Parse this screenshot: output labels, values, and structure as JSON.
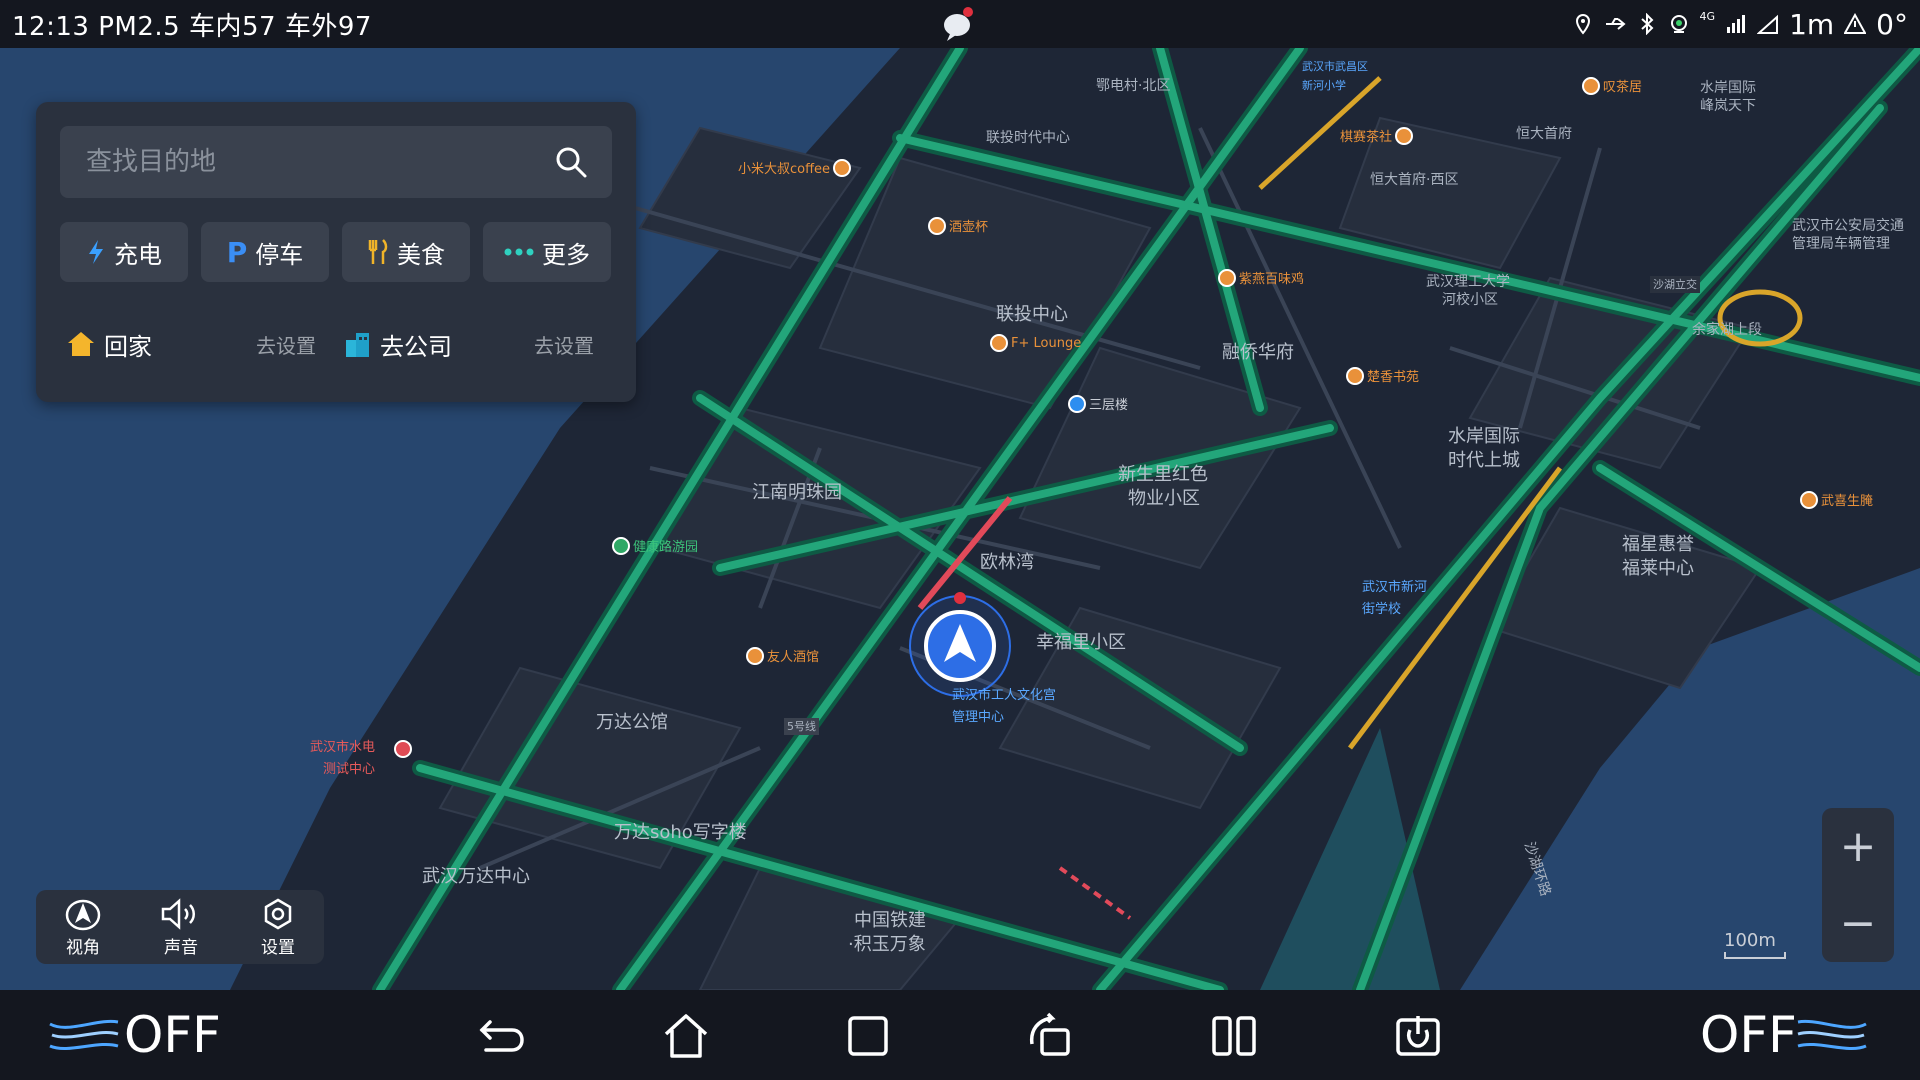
{
  "status_bar": {
    "time": "12:13",
    "pm25": "PM2.5",
    "inside_label": "车内",
    "inside_value": "57",
    "outside_label": "车外",
    "outside_value": "97",
    "signal_label": "4G",
    "distance": "1m",
    "angle": "0°"
  },
  "search": {
    "placeholder": "查找目的地",
    "categories": [
      {
        "label": "充电",
        "icon": "lightning-icon"
      },
      {
        "label": "停车",
        "icon": "parking-icon"
      },
      {
        "label": "美食",
        "icon": "food-icon"
      },
      {
        "label": "更多",
        "icon": "more-dots-icon"
      }
    ],
    "home_label": "回家",
    "home_action": "去设置",
    "company_label": "去公司",
    "company_action": "去设置"
  },
  "view_controls": {
    "perspective_label": "视角",
    "sound_label": "声音",
    "settings_label": "设置"
  },
  "zoom": {
    "in": "+",
    "out": "−",
    "scale": "100m"
  },
  "map_labels": {
    "areas": [
      "鄂电村·北区",
      "联投时代中心",
      "联投中心",
      "融侨华府",
      "武汉理工大学",
      "河校小区",
      "江南明珠园",
      "新生里红色",
      "物业小区",
      "水岸国际",
      "时代上城",
      "欧林湾",
      "幸福里小区",
      "万达公馆",
      "万达soho写字楼",
      "武汉万达中心",
      "中国铁建",
      "·积玉万象",
      "福星惠誉",
      "福莱中心",
      "恒大首府",
      "恒大首府·西区",
      "水岸国际",
      "峰岚天下",
      "武汉市公安局交通",
      "管理局车辆管理",
      "余家湖上段",
      "沙湖环路"
    ],
    "pois": [
      "小米大叔coffee",
      "酒壶杯",
      "F+ Lounge",
      "三层楼",
      "紫燕百味鸡",
      "楚香书苑",
      "棋赛茶社",
      "叹茶居",
      "健康路游园",
      "友人酒馆",
      "武汉市水电",
      "测试中心",
      "武汉市工人文化宫",
      "管理中心",
      "武汉市新河",
      "街学校",
      "武喜生腌",
      "武汉市武昌区",
      "新河小学",
      "沙湖立交",
      "5号线"
    ]
  },
  "bottom_bar": {
    "left_status": "OFF",
    "right_status": "OFF"
  },
  "colors": {
    "road": "#23a67a",
    "road_dark": "#0f5d45",
    "water": "#2a4a72",
    "traffic_red": "#e24a5a",
    "traffic_yellow": "#d9a52a"
  }
}
